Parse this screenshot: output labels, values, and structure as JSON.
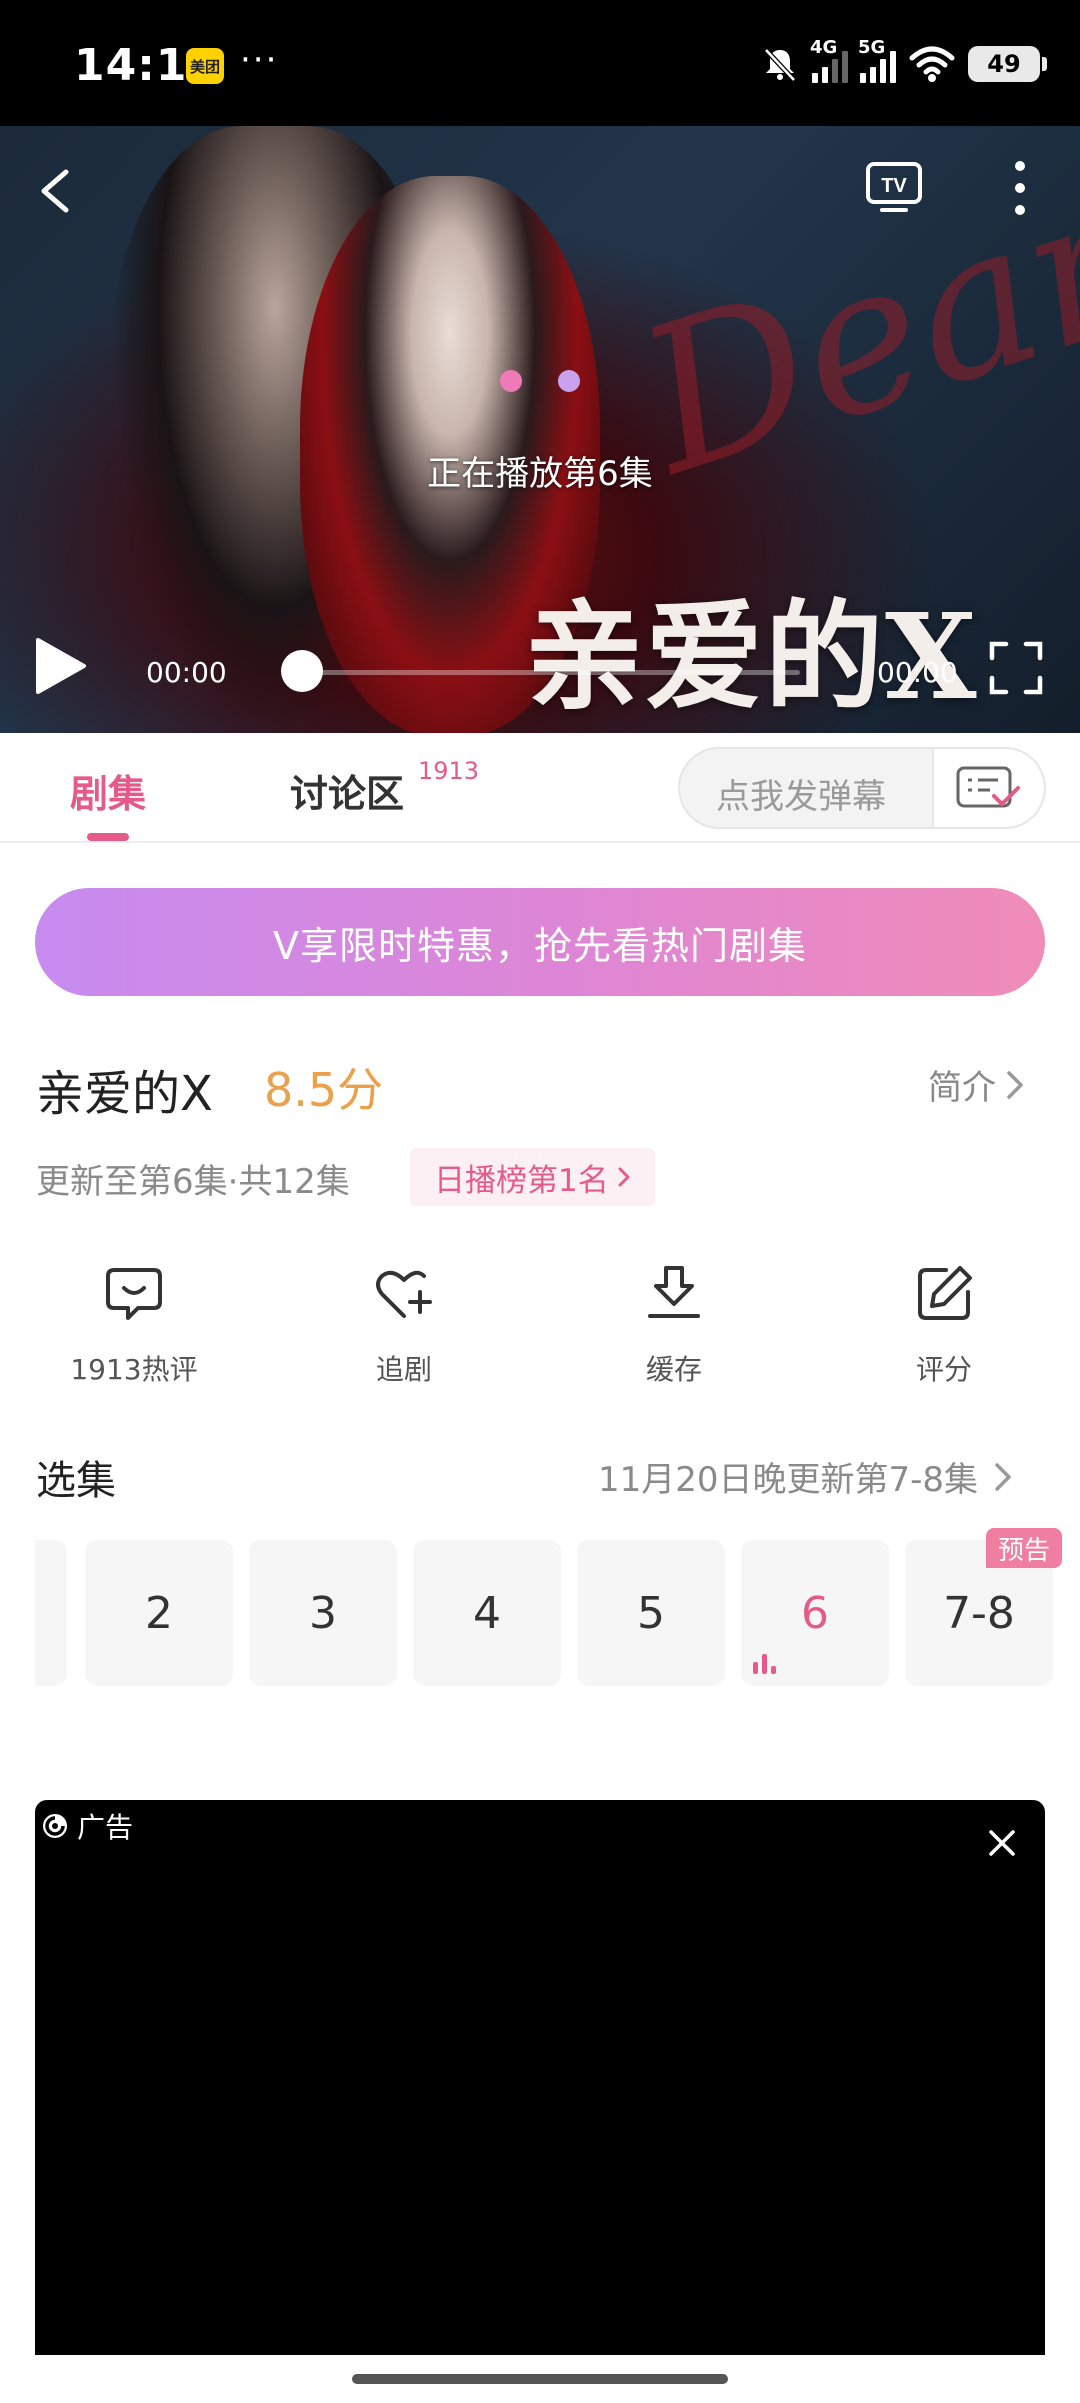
{
  "status_bar": {
    "time": "14:11",
    "app_badge": "美团",
    "more": "···",
    "network_1": "4G",
    "network_2": "5G",
    "battery": "49"
  },
  "player": {
    "now_playing": "正在播放第6集",
    "title_art": "亲爱的X",
    "script_art": "Dear",
    "current_time": "00:00",
    "total_time": "00:00",
    "progress": 0,
    "icons": [
      "back-icon",
      "tv-cast-icon",
      "more-icon",
      "play-icon",
      "fullscreen-icon"
    ]
  },
  "tabs": {
    "episodes": "剧集",
    "discuss": "讨论区",
    "discuss_count": "1913",
    "danmu_placeholder": "点我发弹幕"
  },
  "promo": {
    "text": "V享限时特惠，抢先看热门剧集"
  },
  "show": {
    "title": "亲爱的X",
    "score": "8.5分",
    "intro": "简介",
    "update": "更新至第6集·共12集",
    "rank": "日播榜第1名"
  },
  "actions": [
    {
      "label": "1913热评",
      "icon": "comment-icon"
    },
    {
      "label": "追剧",
      "icon": "heart-plus-icon"
    },
    {
      "label": "缓存",
      "icon": "download-icon"
    },
    {
      "label": "评分",
      "icon": "edit-icon"
    }
  ],
  "episodes": {
    "header": "选集",
    "update_note": "11月20日晚更新第7-8集",
    "items": [
      "2",
      "3",
      "4",
      "5",
      "6",
      "7-8"
    ],
    "active": "6",
    "preview_badge": "预告"
  },
  "ad": {
    "label": "广告"
  },
  "colors": {
    "accent": "#e65a8a",
    "score": "#e9a14b",
    "promo_start": "#c78bf0",
    "promo_end": "#f08cb8"
  }
}
